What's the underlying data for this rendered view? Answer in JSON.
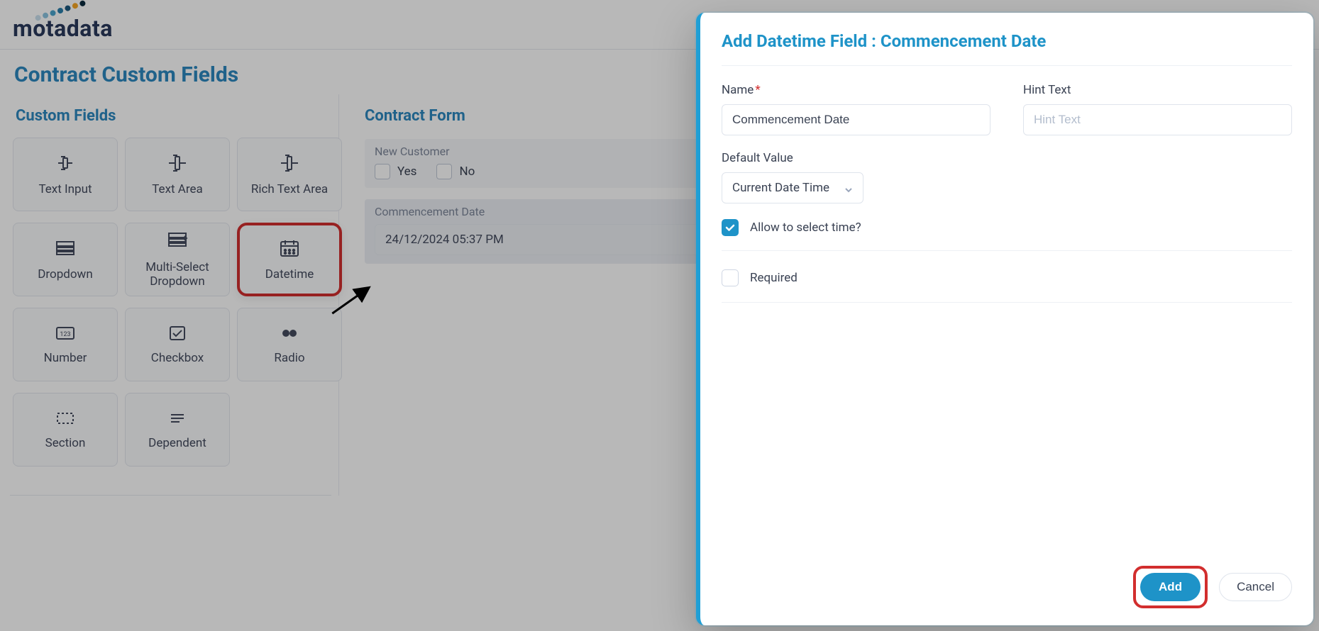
{
  "brand": {
    "name": "motadata"
  },
  "page": {
    "title": "Contract Custom Fields",
    "palette_title": "Custom Fields",
    "preview_title": "Contract Form"
  },
  "palette": [
    {
      "key": "text-input",
      "label": "Text Input"
    },
    {
      "key": "text-area",
      "label": "Text Area"
    },
    {
      "key": "rich-text-area",
      "label": "Rich Text Area"
    },
    {
      "key": "dropdown",
      "label": "Dropdown"
    },
    {
      "key": "multi-select-dropdown",
      "label": "Multi-Select Dropdown"
    },
    {
      "key": "datetime",
      "label": "Datetime"
    },
    {
      "key": "number",
      "label": "Number"
    },
    {
      "key": "checkbox",
      "label": "Checkbox"
    },
    {
      "key": "radio",
      "label": "Radio"
    },
    {
      "key": "section",
      "label": "Section"
    },
    {
      "key": "dependent",
      "label": "Dependent"
    }
  ],
  "preview": {
    "blocks": [
      {
        "key": "new-customer",
        "label": "New Customer",
        "options": {
          "yes": "Yes",
          "no": "No"
        }
      },
      {
        "key": "commencement-date",
        "label": "Commencement Date",
        "value": "24/12/2024 05:37 PM"
      }
    ]
  },
  "panel": {
    "title": "Add Datetime Field : Commencement Date",
    "fields": {
      "name_label": "Name",
      "name_value": "Commencement Date",
      "hint_label": "Hint Text",
      "hint_placeholder": "Hint Text",
      "default_label": "Default Value",
      "default_value": "Current Date  Time",
      "allow_time_label": "Allow to select time?",
      "allow_time_checked": true,
      "required_label": "Required",
      "required_checked": false
    },
    "actions": {
      "add": "Add",
      "cancel": "Cancel"
    }
  }
}
